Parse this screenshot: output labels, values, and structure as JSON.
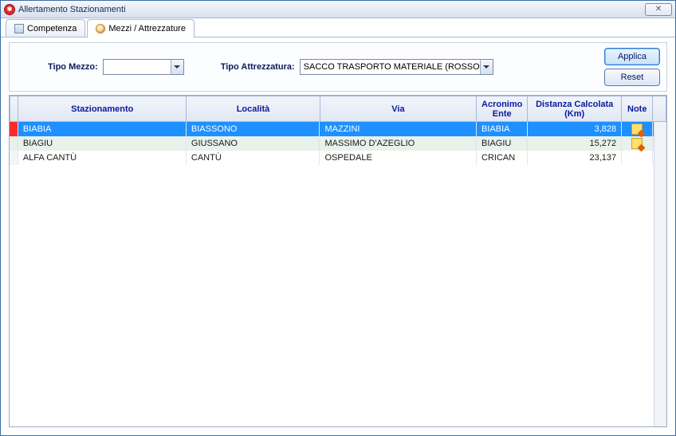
{
  "window": {
    "title": "Allertamento Stazionamenti"
  },
  "tabs": [
    {
      "label": "Competenza",
      "icon": "grid"
    },
    {
      "label": "Mezzi / Attrezzature",
      "icon": "people"
    }
  ],
  "filters": {
    "tipo_mezzo_label": "Tipo Mezzo:",
    "tipo_mezzo_value": "",
    "tipo_attrezzatura_label": "Tipo Attrezzatura:",
    "tipo_attrezzatura_value": "SACCO TRASPORTO MATERIALE (ROSSO"
  },
  "buttons": {
    "applica": "Applica",
    "reset": "Reset"
  },
  "columns": {
    "stazionamento": "Stazionamento",
    "localita": "Località",
    "via": "Via",
    "acronimo": "Acronimo Ente",
    "distanza": "Distanza Calcolata (Km)",
    "note": "Note"
  },
  "rows": [
    {
      "stazionamento": "BIABIA",
      "localita": "BIASSONO",
      "via": "MAZZINI",
      "acronimo": "BIABIA",
      "distanza": "3,828",
      "selected": true,
      "note": true
    },
    {
      "stazionamento": "BIAGIU",
      "localita": "GIUSSANO",
      "via": "MASSIMO D'AZEGLIO",
      "acronimo": "BIAGIU",
      "distanza": "15,272",
      "alt": true,
      "note": true
    },
    {
      "stazionamento": "ALFA CANTÙ",
      "localita": "CANTÙ",
      "via": "OSPEDALE",
      "acronimo": "CRICAN",
      "distanza": "23,137"
    }
  ]
}
